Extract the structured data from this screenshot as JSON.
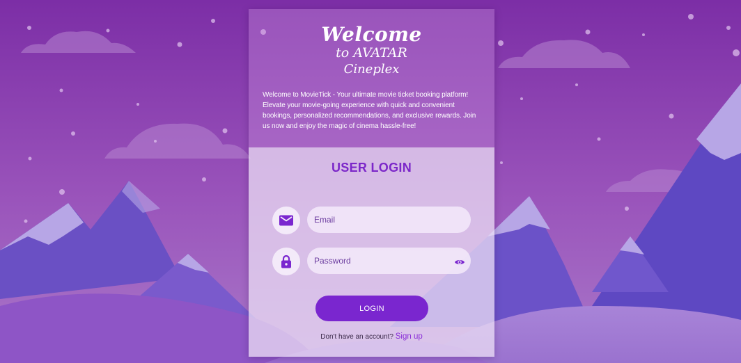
{
  "welcome": {
    "line1": "Welcome",
    "line2": "to AVATAR",
    "line3": "Cineplex"
  },
  "intro_text": "Welcome to MovieTick - Your ultimate movie ticket booking platform! Elevate your movie-going experience with quick and convenient bookings, personalized recommendations, and exclusive rewards. Join us now and enjoy the magic of cinema hassle-free!",
  "login": {
    "title": "USER LOGIN",
    "email_placeholder": "Email",
    "email_value": "",
    "password_placeholder": "Password",
    "password_value": "",
    "button_label": "LOGIN"
  },
  "signup": {
    "prompt": "Don't have an account?",
    "link_label": "Sign up"
  },
  "icons": {
    "email": "mail-icon",
    "password": "lock-icon",
    "toggle_password": "eye-icon"
  },
  "colors": {
    "accent": "#7a26cf",
    "title": "#7c27c9",
    "link": "#8a2fd8",
    "sky_top": "#7c2ea6",
    "sky_bottom": "#a56ac4",
    "mountain": "#6a50c4",
    "snow": "#b7a6e6"
  }
}
